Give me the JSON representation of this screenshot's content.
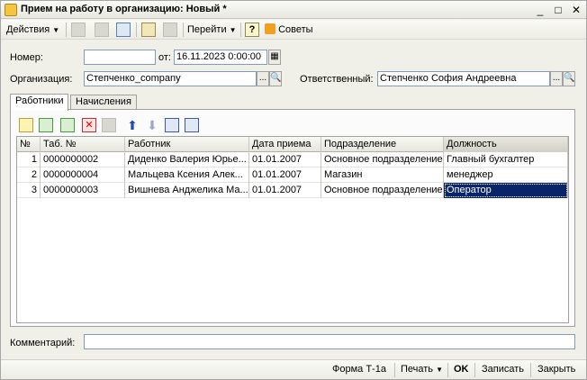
{
  "window": {
    "title": "Прием на работу в организацию: Новый *",
    "minimize": "_",
    "maximize": "□",
    "close": "✕"
  },
  "toolbar": {
    "actions_label": "Действия",
    "goto_label": "Перейти",
    "help_label": "?",
    "tips_label": "Советы"
  },
  "form": {
    "number_label": "Номер:",
    "number_value": "",
    "date_label": "от:",
    "date_value": "16.11.2023  0:00:00",
    "organization_label": "Организация:",
    "organization_value": "Степченко_company",
    "responsible_label": "Ответственный:",
    "responsible_value": "Степченко София Андреевна",
    "comment_label": "Комментарий:",
    "comment_value": ""
  },
  "tabs": [
    {
      "label": "Работники",
      "active": true
    },
    {
      "label": "Начисления",
      "active": false
    }
  ],
  "grid": {
    "columns": [
      "№",
      "Таб. №",
      "Работник",
      "Дата приема",
      "Подразделение",
      "Должность"
    ],
    "rows": [
      [
        "1",
        "0000000002",
        "Диденко Валерия Юрье...",
        "01.01.2007",
        "Основное подразделение",
        "Главный бухгалтер"
      ],
      [
        "2",
        "0000000004",
        "Мальцева Ксения Алек...",
        "01.01.2007",
        "Магазин",
        "менеджер"
      ],
      [
        "3",
        "0000000003",
        "Вишнева Анджелика Ма...",
        "01.01.2007",
        "Основное подразделение",
        "Оператор"
      ]
    ]
  },
  "bottom": {
    "form_t1a": "Форма Т-1а",
    "print_label": "Печать",
    "ok_label": "OK",
    "save_label": "Записать",
    "close_label": "Закрыть"
  },
  "colors": {
    "selection": "#0a246a",
    "accent": "#f4c542"
  }
}
